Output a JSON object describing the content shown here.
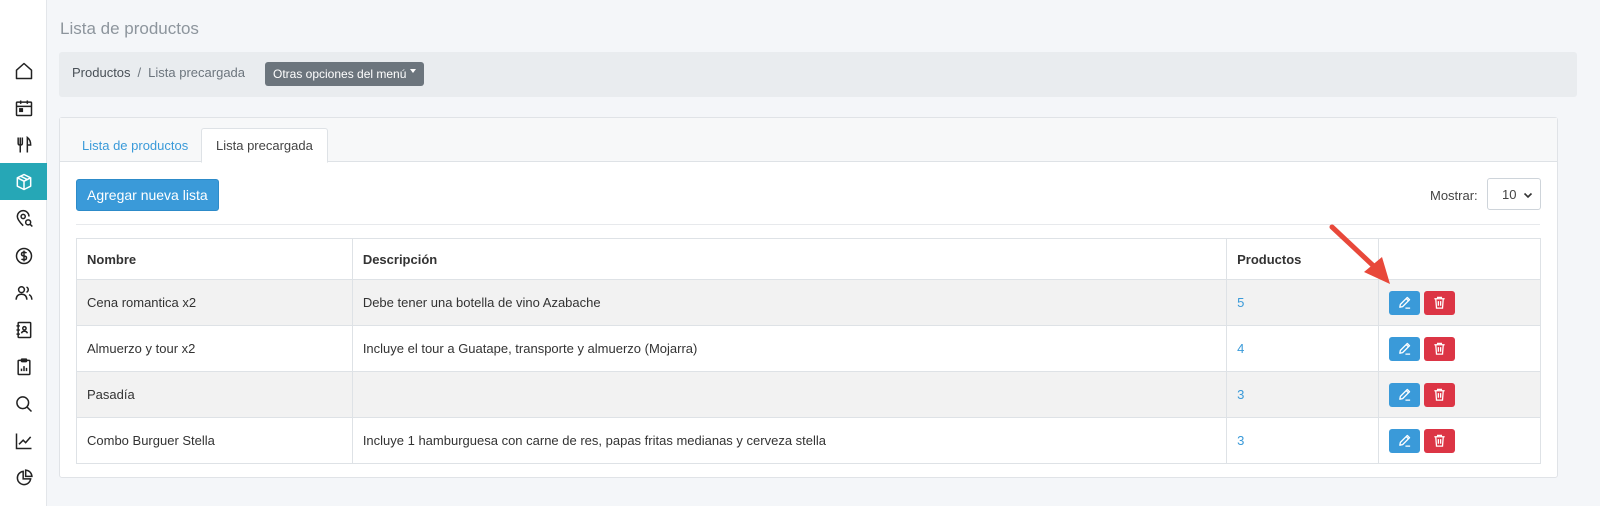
{
  "page": {
    "title": "Lista de productos"
  },
  "breadcrumb": {
    "root": "Productos",
    "separator": "/",
    "current": "Lista precargada"
  },
  "menu_button": {
    "label": "Otras opciones del menú"
  },
  "tabs": [
    {
      "label": "Lista de productos",
      "active": false
    },
    {
      "label": "Lista precargada",
      "active": true
    }
  ],
  "toolbar": {
    "add_label": "Agregar nueva lista",
    "show_label": "Mostrar:",
    "show_value": "10"
  },
  "sidebar": {
    "items": [
      {
        "icon": "home-icon",
        "active": false
      },
      {
        "icon": "calendar-icon",
        "active": false
      },
      {
        "icon": "utensils-icon",
        "active": false
      },
      {
        "icon": "box-icon",
        "active": true
      },
      {
        "icon": "location-search-icon",
        "active": false
      },
      {
        "icon": "dollar-icon",
        "active": false
      },
      {
        "icon": "users-icon",
        "active": false
      },
      {
        "icon": "contacts-book-icon",
        "active": false
      },
      {
        "icon": "clipboard-icon",
        "active": false
      },
      {
        "icon": "search-icon",
        "active": false
      },
      {
        "icon": "line-chart-icon",
        "active": false
      },
      {
        "icon": "pie-chart-icon",
        "active": false
      }
    ]
  },
  "table": {
    "headers": [
      "Nombre",
      "Descripción",
      "Productos",
      ""
    ],
    "rows": [
      {
        "name": "Cena romantica x2",
        "description": "Debe tener una botella de vino Azabache",
        "count": "5"
      },
      {
        "name": "Almuerzo y tour x2",
        "description": "Incluye el tour a Guatape, transporte y almuerzo (Mojarra)",
        "count": "4"
      },
      {
        "name": "Pasadía",
        "description": "",
        "count": "3"
      },
      {
        "name": "Combo Burguer Stella",
        "description": "Incluye 1 hamburguesa con carne de res, papas fritas medianas y cerveza stella",
        "count": "3"
      }
    ]
  },
  "colors": {
    "accent": "#3a9ad9",
    "sidebar_active": "#26a7b6",
    "danger": "#dc3545",
    "annotation_arrow": "#e8483a"
  }
}
